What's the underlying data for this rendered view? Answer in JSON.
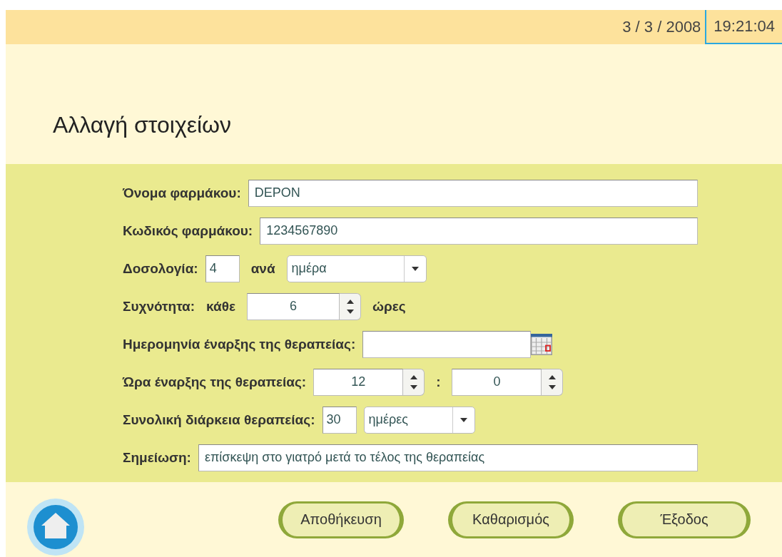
{
  "header": {
    "date": "3 / 3 / 2008",
    "time": "19:21:04"
  },
  "title": "Αλλαγή στοιχείων",
  "form": [
    {
      "label": "Όνομα φαρμάκου:",
      "parts": [
        {
          "kind": "field",
          "value": "DEPON"
        }
      ]
    },
    {
      "label": "Κωδικός φαρμάκου:",
      "parts": [
        {
          "kind": "field",
          "value": "1234567890"
        }
      ]
    },
    {
      "label": "Δοσολογία:",
      "parts": [
        {
          "kind": "short-field",
          "value": "4"
        },
        {
          "kind": "text",
          "value": "ανά"
        },
        {
          "kind": "select",
          "value": "ημέρα"
        }
      ]
    },
    {
      "label": "Συχνότητα:",
      "parts": [
        {
          "kind": "text",
          "value": "κάθε"
        },
        {
          "kind": "spinner",
          "value": "6"
        },
        {
          "kind": "text",
          "value": "ώρες"
        }
      ]
    },
    {
      "label": "Ημερομηνία έναρξης της θεραπείας:",
      "parts": [
        {
          "kind": "date"
        }
      ]
    },
    {
      "label": "Ώρα έναρξης της θεραπείας:",
      "parts": [
        {
          "kind": "spinner",
          "value": "12"
        },
        {
          "kind": "text",
          "value": ":"
        },
        {
          "kind": "spinner",
          "value": "0"
        }
      ]
    },
    {
      "label": "Συνολική διάρκεια θεραπείας:",
      "parts": [
        {
          "kind": "short-field",
          "value": "30"
        },
        {
          "kind": "select",
          "value": "ημέρες"
        }
      ]
    },
    {
      "label": "Σημείωση:",
      "parts": [
        {
          "kind": "field",
          "value": "επίσκεψη στο γιατρό μετά το τέλος της θεραπείας"
        }
      ]
    }
  ],
  "buttons": [
    "Αποθήκευση",
    "Καθαρισμός",
    "Έξοδος"
  ]
}
